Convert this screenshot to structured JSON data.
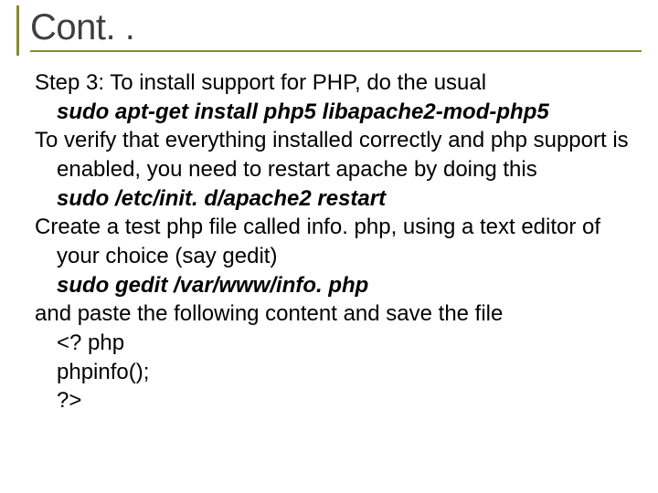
{
  "slide": {
    "title": "Cont. .",
    "line1": "Step 3: To install support for PHP, do the usual",
    "cmd1": "sudo apt-get install php5 libapache2-mod-php5",
    "line2": "To verify that everything installed correctly and php support is enabled, you need to restart apache by doing this",
    "cmd2": "sudo /etc/init. d/apache2 restart",
    "line3": "Create a test php file called info. php, using a text editor of your choice (say gedit)",
    "cmd3": "sudo gedit /var/www/info. php",
    "line4": "and paste the following content and save the file",
    "code1": "<? php",
    "code2": "phpinfo();",
    "code3": "?>"
  }
}
